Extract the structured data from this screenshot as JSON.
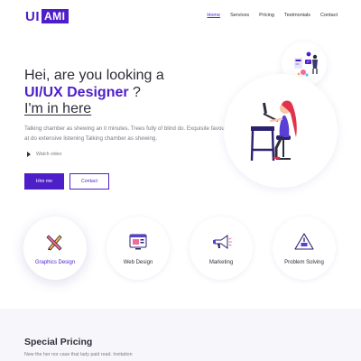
{
  "brand": {
    "logo_ui": "UI",
    "logo_ami": "AMI"
  },
  "nav": [
    {
      "label": "Home",
      "active": true
    },
    {
      "label": "Services"
    },
    {
      "label": "Pricing"
    },
    {
      "label": "Testmonials"
    },
    {
      "label": "Contact"
    }
  ],
  "hero": {
    "line1": "Hei, are you looking a",
    "line2_accent": "UI/UX Designer",
    "line2_suffix": " ?",
    "line3": "I'm in here",
    "description": "Talking chamber as shewing an it minutes. Trees fully of blind do. Exquisite favourite at do extensive listening Talking chamber as shewing.",
    "watch_label": "Watch video",
    "hire_label": "Hire me",
    "contact_label": "Contact"
  },
  "services": [
    {
      "label": "Graphics Design",
      "icon": "pencil-ruler-icon",
      "active": true
    },
    {
      "label": "Web Design",
      "icon": "web-browser-icon"
    },
    {
      "label": "Marketing",
      "icon": "megaphone-icon"
    },
    {
      "label": "Problem Solving",
      "icon": "warning-triangle-icon"
    }
  ],
  "pricing": {
    "title": "Special Pricing",
    "subtitle": "New the her nor case that lady paid read. Invitation"
  },
  "colors": {
    "accent": "#4e1fc9",
    "text": "#2d2d3a",
    "muted": "#7a7a86",
    "pricing_bg": "#f7f7fb"
  }
}
